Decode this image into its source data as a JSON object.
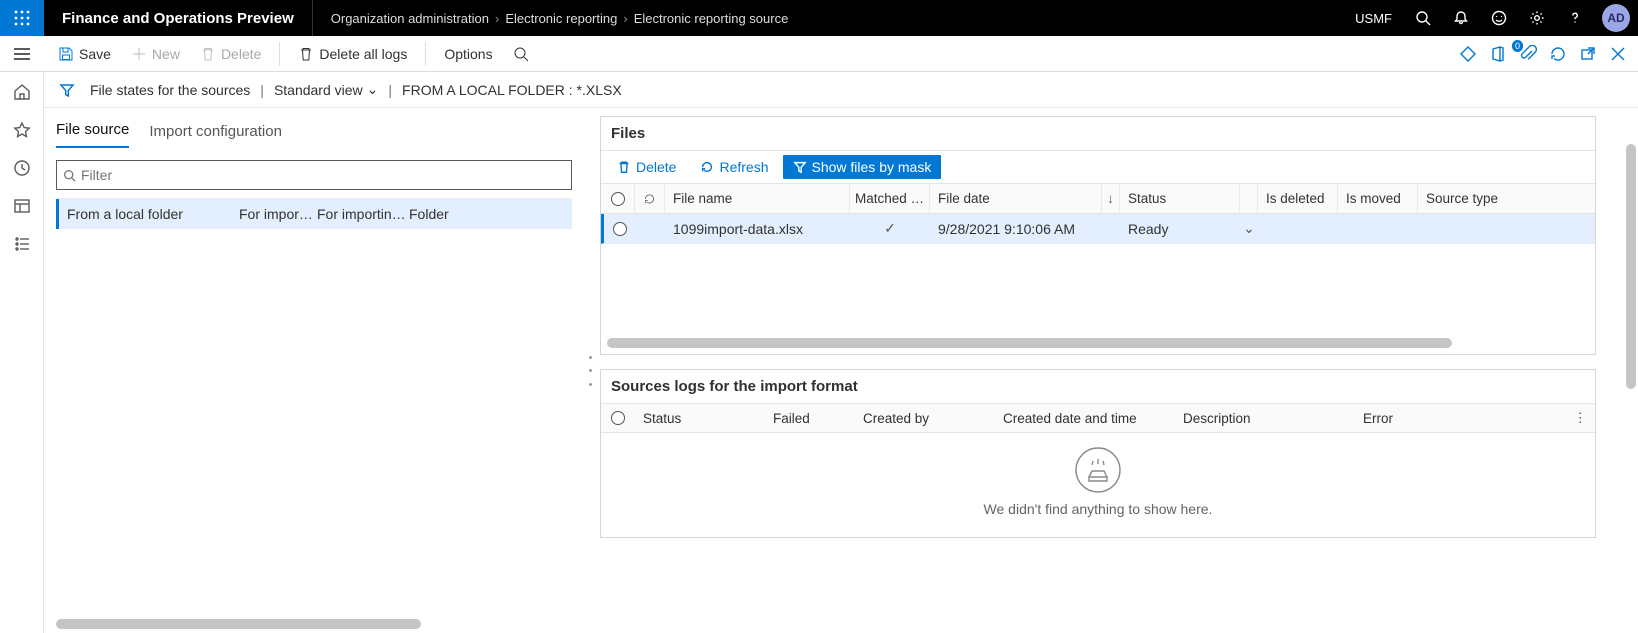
{
  "topbar": {
    "app_title": "Finance and Operations Preview",
    "breadcrumbs": [
      "Organization administration",
      "Electronic reporting",
      "Electronic reporting source"
    ],
    "company": "USMF",
    "avatar": "AD"
  },
  "actions": {
    "save": "Save",
    "new": "New",
    "delete": "Delete",
    "delete_all_logs": "Delete all logs",
    "options": "Options",
    "attach_badge": "0"
  },
  "filterbar": {
    "title": "File states for the sources",
    "view": "Standard view",
    "context": "FROM A LOCAL FOLDER : *.XLSX"
  },
  "tabs": {
    "file_source": "File source",
    "import_config": "Import configuration"
  },
  "filter_placeholder": "Filter",
  "file_source_row": {
    "c1": "From a local folder",
    "c2": "For impor…",
    "c3": "For importin…",
    "c4": "Folder"
  },
  "files_card": {
    "title": "Files",
    "btn_delete": "Delete",
    "btn_refresh": "Refresh",
    "btn_mask": "Show files by mask",
    "cols": {
      "file_name": "File name",
      "matched": "Matched …",
      "file_date": "File date",
      "status": "Status",
      "is_deleted": "Is deleted",
      "is_moved": "Is moved",
      "source_type": "Source type"
    },
    "row": {
      "file_name": "1099import-data.xlsx",
      "matched": "✓",
      "file_date": "9/28/2021 9:10:06 AM",
      "status": "Ready"
    }
  },
  "logs_card": {
    "title": "Sources logs for the import format",
    "cols": {
      "status": "Status",
      "failed": "Failed",
      "created_by": "Created by",
      "created_dt": "Created date and time",
      "description": "Description",
      "error": "Error"
    },
    "empty": "We didn't find anything to show here."
  }
}
